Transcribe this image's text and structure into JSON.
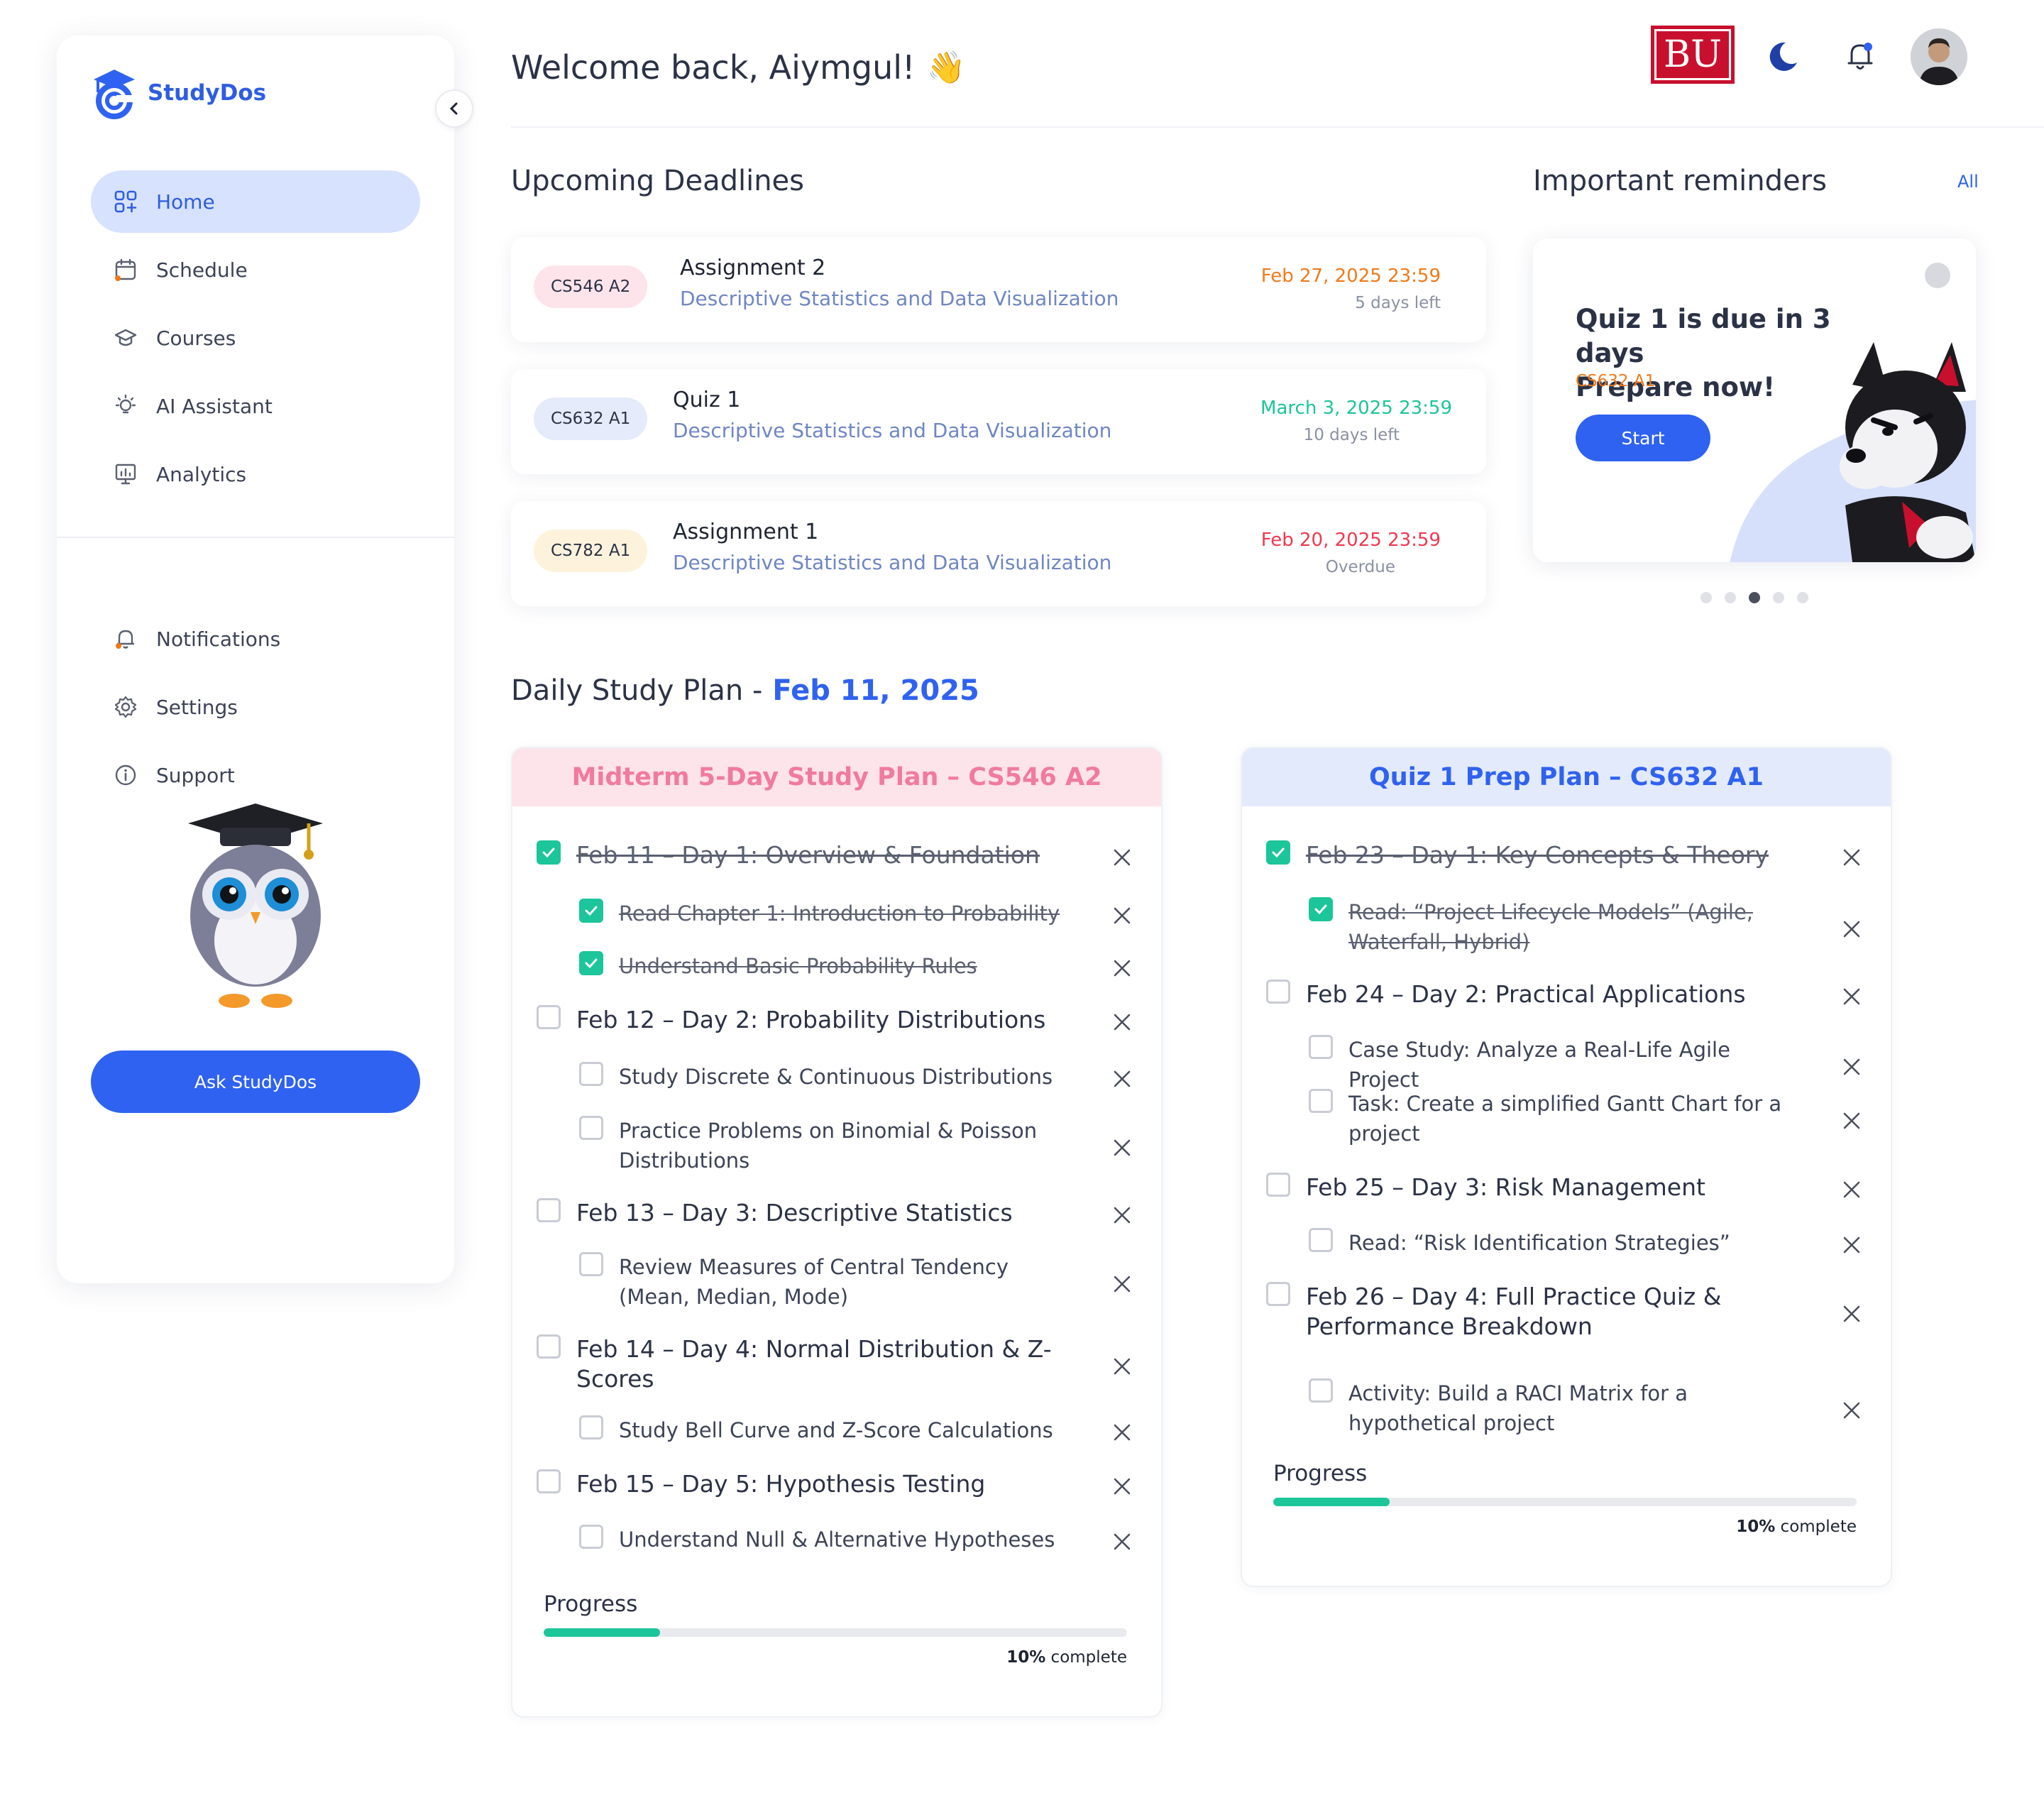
{
  "app": {
    "name": "StudyDos"
  },
  "sidebar": {
    "nav": [
      {
        "label": "Home",
        "icon": "grid-icon",
        "active": true
      },
      {
        "label": "Schedule",
        "icon": "calendar-icon"
      },
      {
        "label": "Courses",
        "icon": "graduation-cap-icon"
      },
      {
        "label": "AI Assistant",
        "icon": "lightbulb-icon"
      },
      {
        "label": "Analytics",
        "icon": "presentation-chart-icon"
      }
    ],
    "nav2": [
      {
        "label": "Notifications",
        "icon": "bell-icon"
      },
      {
        "label": "Settings",
        "icon": "gear-icon"
      },
      {
        "label": "Support",
        "icon": "info-icon"
      }
    ],
    "ask_button": "Ask StudyDos"
  },
  "header": {
    "welcome": "Welcome back, Aiymgul!",
    "wave": "👋",
    "university_logo": "BU"
  },
  "deadlines": {
    "title": "Upcoming Deadlines",
    "items": [
      {
        "badge": "CS546 A2",
        "title": "Assignment  2",
        "subtitle": "Descriptive Statistics and Data Visualization",
        "date": "Feb 27, 2025 23:59",
        "remaining": "5 days left",
        "badge_color": "#fde3ea",
        "date_color": "#f07a1a"
      },
      {
        "badge": "CS632 A1",
        "title": "Quiz 1",
        "subtitle": "Descriptive Statistics and Data Visualization",
        "date": "March 3, 2025 23:59",
        "remaining": "10 days left",
        "badge_color": "#e6ebfb",
        "date_color": "#1cc59a"
      },
      {
        "badge": "CS782 A1",
        "title": "Assignment  1",
        "subtitle": "Descriptive Statistics and Data Visualization",
        "date": "Feb 20, 2025 23:59",
        "remaining": "Overdue",
        "badge_color": "#fdf3dc",
        "date_color": "#f0394f"
      }
    ]
  },
  "reminders": {
    "title": "Important reminders",
    "all_link": "All",
    "card": {
      "title_line1": "Quiz 1 is due in 3 days",
      "title_line2": "Prepare now!",
      "code": "CS632 A1",
      "button": "Start"
    },
    "pagination": {
      "count": 5,
      "active": 3
    }
  },
  "study_plan": {
    "title": "Daily Study Plan -",
    "date": "Feb 11, 2025",
    "plans": [
      {
        "title": "Midterm 5-Day Study Plan – CS546 A2",
        "header_bg": "#fde3ea",
        "header_color": "#f07aa0",
        "progress_label": "Progress",
        "progress_fraction": 0.2,
        "progress_pct": "10%",
        "progress_suffix": " complete",
        "tasks": [
          {
            "text": "Feb 11 – Day 1: Overview & Foundation",
            "level": "day",
            "done": true
          },
          {
            "text": "Read Chapter 1: Introduction to Probability",
            "level": "sub",
            "done": true
          },
          {
            "text": "Understand Basic Probability Rules",
            "level": "sub",
            "done": true
          },
          {
            "text": "Feb 12 – Day 2: Probability Distributions",
            "level": "day",
            "done": false
          },
          {
            "text": "Study Discrete & Continuous Distributions",
            "level": "sub",
            "done": false
          },
          {
            "text": "Practice Problems on Binomial & Poisson Distributions",
            "level": "sub",
            "done": false
          },
          {
            "text": "Feb 13 – Day 3: Descriptive Statistics",
            "level": "day",
            "done": false
          },
          {
            "text": "Review Measures of Central Tendency (Mean, Median, Mode)",
            "level": "sub",
            "done": false
          },
          {
            "text": "Feb 14 – Day 4: Normal Distribution & Z-Scores",
            "level": "day",
            "done": false
          },
          {
            "text": "Study Bell Curve and Z-Score Calculations",
            "level": "sub",
            "done": false
          },
          {
            "text": "Feb 15 – Day 5: Hypothesis Testing",
            "level": "day",
            "done": false
          },
          {
            "text": "Understand Null & Alternative Hypotheses",
            "level": "sub",
            "done": false
          }
        ]
      },
      {
        "title": "Quiz 1 Prep Plan – CS632 A1",
        "header_bg": "#e3eafc",
        "header_color": "#2f62f0",
        "progress_label": "Progress",
        "progress_fraction": 0.2,
        "progress_pct": "10%",
        "progress_suffix": " complete",
        "tasks": [
          {
            "text": "Feb 23 – Day 1: Key Concepts & Theory",
            "level": "day",
            "done": true
          },
          {
            "text": "Read: “Project Lifecycle Models” (Agile, Waterfall, Hybrid)",
            "level": "sub",
            "done": true
          },
          {
            "text": "Feb 24 – Day 2: Practical Applications",
            "level": "day",
            "done": false
          },
          {
            "text": "Case Study: Analyze a Real-Life Agile Project",
            "level": "sub",
            "done": false
          },
          {
            "text": "Task: Create a simplified Gantt Chart for a project",
            "level": "sub",
            "done": false
          },
          {
            "text": "Feb 25 – Day 3: Risk Management",
            "level": "day",
            "done": false
          },
          {
            "text": "Read: “Risk Identification Strategies”",
            "level": "sub",
            "done": false
          },
          {
            "text": "Feb 26 – Day 4: Full Practice Quiz & Performance Breakdown",
            "level": "day",
            "done": false
          },
          {
            "text": "Activity: Build a RACI Matrix for a hypothetical project",
            "level": "sub",
            "done": false
          }
        ]
      }
    ]
  }
}
